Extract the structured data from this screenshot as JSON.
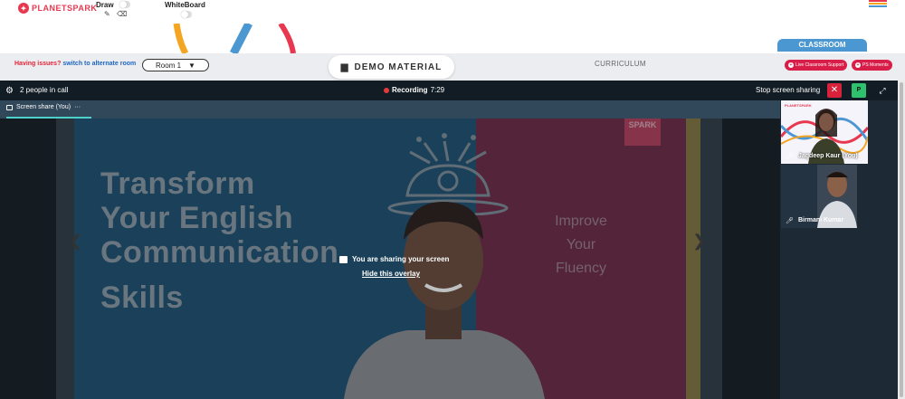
{
  "brand": {
    "logo_text": "PLANETSPARK"
  },
  "tools": {
    "draw_label": "Draw",
    "whiteboard_label": "WhiteBoard"
  },
  "toolbar": {
    "issues_text": "Having issues?",
    "alternate_room_link": "switch to alternate room",
    "room_select": "Room 1",
    "demo_material": "DEMO MATERIAL",
    "curriculum": "CURRICULUM",
    "classroom_tab": "CLASSROOM",
    "live_support": "Live Classroom Support",
    "ps_moments": "PS Moments"
  },
  "call": {
    "people_count": "2 people in call",
    "recording_label": "Recording",
    "recording_time": "7:29",
    "stop_sharing": "Stop screen sharing",
    "p_button": "P",
    "tab_label": "Screen share (You)",
    "tab_more": "···"
  },
  "slide": {
    "lines": [
      "Transform",
      "Your English",
      "Communication",
      "Skills"
    ],
    "improve": [
      "Improve",
      "Your",
      "Fluency"
    ],
    "spark_text": "SPARK"
  },
  "overlay": {
    "sharing_msg": "You are sharing your screen",
    "hide_link": "Hide this overlay"
  },
  "participants": [
    {
      "name": "Jagdeep Kaur (You)"
    },
    {
      "name": "Birmani Kumar"
    }
  ],
  "colors": {
    "brand_red": "#e8384f",
    "classroom_blue": "#4b97d2",
    "recording_red": "#e23b3b",
    "stop_red": "#d8213a",
    "p_green": "#2fc26e"
  }
}
